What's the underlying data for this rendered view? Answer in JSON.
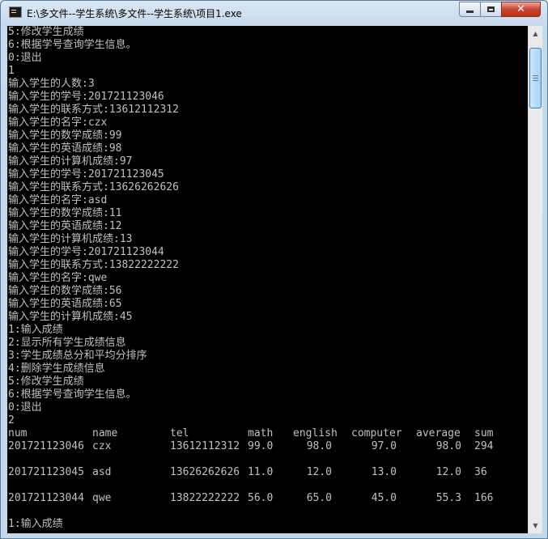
{
  "window": {
    "title": "E:\\多文件--学生系统\\多文件--学生系统\\项目1.exe"
  },
  "icons": {
    "app": "console-app-icon",
    "minimize": "minimize-icon",
    "maximize": "maximize-icon",
    "close": "close-icon",
    "scroll_up": "scroll-up-arrow-icon",
    "scroll_down": "scroll-down-arrow-icon"
  },
  "console": {
    "lines_before": [
      "5:修改学生成绩",
      "6:根据学号查询学生信息。",
      "0:退出",
      "1",
      "输入学生的人数:3",
      "输入学生的学号:201721123046",
      "输入学生的联系方式:13612112312",
      "输入学生的名字:czx",
      "输入学生的数学成绩:99",
      "输入学生的英语成绩:98",
      "输入学生的计算机成绩:97",
      "输入学生的学号:201721123045",
      "输入学生的联系方式:13626262626",
      "输入学生的名字:asd",
      "输入学生的数学成绩:11",
      "输入学生的英语成绩:12",
      "输入学生的计算机成绩:13",
      "输入学生的学号:201721123044",
      "输入学生的联系方式:13822222222",
      "输入学生的名字:qwe",
      "输入学生的数学成绩:56",
      "输入学生的英语成绩:65",
      "输入学生的计算机成绩:45",
      "1:输入成绩",
      "2:显示所有学生成绩信息",
      "3:学生成绩总分和平均分排序",
      "4:删除学生成绩信息",
      "5:修改学生成绩",
      "6:根据学号查询学生信息。",
      "0:退出",
      "2"
    ],
    "table": {
      "columns": [
        "num",
        "name",
        "tel",
        "math",
        "english",
        "computer",
        "average",
        "sum"
      ],
      "rows": [
        [
          "201721123046",
          "czx",
          "13612112312",
          "99.0",
          "98.0",
          "97.0",
          "98.0",
          "294"
        ],
        [
          "201721123045",
          "asd",
          "13626262626",
          "11.0",
          "12.0",
          "13.0",
          "12.0",
          "36"
        ],
        [
          "201721123044",
          "qwe",
          "13822222222",
          "56.0",
          "65.0",
          "45.0",
          "55.3",
          "166"
        ]
      ]
    },
    "lines_after": [
      "1:输入成绩"
    ]
  }
}
